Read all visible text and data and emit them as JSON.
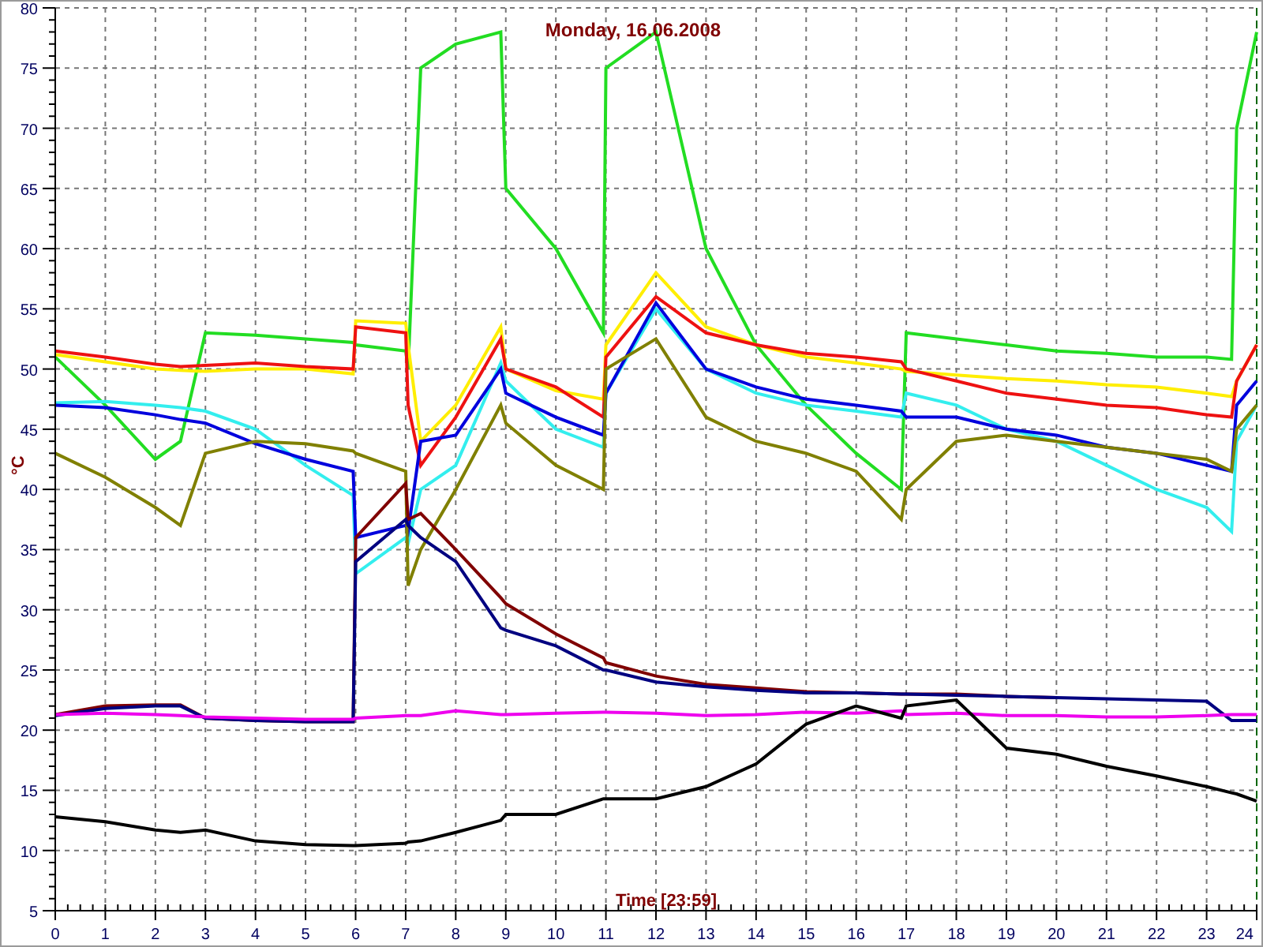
{
  "chart": {
    "chart_data": {
      "type": "line",
      "title": "Monday, 16.06.2008",
      "xlabel": "Time [23:59]",
      "ylabel": "°C",
      "x": [
        0,
        1,
        2,
        2.5,
        3,
        4,
        5,
        5.95,
        6,
        7,
        7.05,
        7.3,
        8,
        8.9,
        9,
        10,
        10.95,
        11,
        12,
        13,
        14,
        15,
        16,
        16.9,
        17,
        18,
        19,
        20,
        21,
        22,
        23,
        23.5,
        23.6,
        24
      ],
      "grid": true,
      "xlim": [
        0,
        24
      ],
      "ylim": [
        5,
        80
      ],
      "xticks": [
        0,
        1,
        2,
        3,
        4,
        5,
        6,
        7,
        8,
        9,
        10,
        11,
        12,
        13,
        14,
        15,
        16,
        17,
        18,
        19,
        20,
        21,
        22,
        23,
        24
      ],
      "yticks": [
        5,
        10,
        15,
        20,
        25,
        30,
        35,
        40,
        45,
        50,
        55,
        60,
        65,
        70,
        75,
        80
      ],
      "series": [
        {
          "color": "#22dd22",
          "values": [
            51,
            47,
            42.5,
            44,
            53,
            52.8,
            52.5,
            52.2,
            52,
            51.5,
            50,
            75,
            77,
            78,
            65,
            60,
            53,
            75,
            78,
            60,
            52,
            47,
            43,
            40,
            53,
            52.5,
            52,
            51.5,
            51.3,
            51,
            51,
            50.8,
            70,
            78
          ]
        },
        {
          "color": "#ffee00",
          "values": [
            51.2,
            50.6,
            50,
            49.9,
            49.8,
            50,
            50,
            49.6,
            54,
            53.8,
            52,
            44,
            47,
            53.5,
            50,
            48.2,
            47.5,
            52,
            58,
            53.5,
            52,
            51,
            50.5,
            50,
            49.8,
            49.5,
            49.2,
            49,
            48.7,
            48.5,
            48,
            47.7,
            49,
            52
          ]
        },
        {
          "color": "#ee1111",
          "values": [
            51.5,
            51,
            50.4,
            50.2,
            50.3,
            50.5,
            50.2,
            50,
            53.5,
            53,
            47,
            42,
            46,
            52.5,
            50,
            48.5,
            46,
            51,
            56,
            53,
            52,
            51.3,
            51,
            50.6,
            50,
            49,
            48,
            47.5,
            47,
            46.8,
            46.2,
            46,
            49,
            52
          ]
        },
        {
          "color": "#33eeee",
          "values": [
            47.2,
            47.3,
            47,
            46.8,
            46.5,
            45,
            42,
            39.5,
            33,
            36,
            35.5,
            40,
            42,
            50.5,
            49,
            45,
            43.5,
            48,
            55,
            50,
            48,
            47,
            46.5,
            46,
            48,
            47,
            45,
            44,
            42,
            40,
            38.5,
            36.5,
            44,
            47
          ]
        },
        {
          "color": "#0000dd",
          "values": [
            47,
            46.8,
            46.2,
            45.8,
            45.5,
            43.8,
            42.5,
            41.5,
            36,
            37,
            36.5,
            44,
            44.5,
            50,
            48,
            46,
            44.5,
            48,
            55.5,
            50,
            48.5,
            47.5,
            47,
            46.5,
            46,
            46,
            45,
            44.5,
            43.5,
            43,
            42,
            41.5,
            47,
            49
          ]
        },
        {
          "color": "#808000",
          "values": [
            43,
            41,
            38.5,
            37,
            43,
            44,
            43.8,
            43.2,
            43,
            41.5,
            32,
            35,
            40,
            47,
            45.5,
            42,
            40,
            50,
            52.5,
            46,
            44,
            43,
            41.5,
            37.5,
            40,
            44,
            44.5,
            44,
            43.5,
            43,
            42.5,
            41.5,
            45,
            47
          ]
        },
        {
          "color": "#800000",
          "values": [
            21.3,
            22,
            22.1,
            22.1,
            21,
            20.8,
            20.7,
            20.7,
            36,
            40.5,
            37.5,
            38,
            35,
            31,
            30.5,
            28,
            26,
            25.6,
            24.5,
            23.8,
            23.5,
            23.2,
            23.1,
            23,
            23,
            23,
            22.8,
            22.7,
            null,
            null,
            null,
            null,
            null,
            null
          ]
        },
        {
          "color": "#000080",
          "values": [
            21.2,
            21.8,
            22,
            22,
            21,
            20.8,
            20.7,
            20.7,
            34,
            37.5,
            37,
            36,
            34,
            28.5,
            28.3,
            27,
            25,
            25,
            24,
            23.6,
            23.3,
            23.1,
            23.1,
            23,
            23,
            22.9,
            22.8,
            22.7,
            22.6,
            22.5,
            22.4,
            20.8,
            20.8,
            20.8
          ]
        },
        {
          "color": "#ee00ee",
          "values": [
            21.3,
            21.4,
            21.3,
            21.2,
            21.1,
            21,
            20.9,
            20.9,
            21,
            21.2,
            21.2,
            21.2,
            21.6,
            21.3,
            21.3,
            21.4,
            21.5,
            21.5,
            21.4,
            21.2,
            21.3,
            21.5,
            21.4,
            21.6,
            21.3,
            21.4,
            21.2,
            21.2,
            21.1,
            21.1,
            21.2,
            21.3,
            21.3,
            21.3
          ]
        },
        {
          "color": "#000000",
          "values": [
            12.8,
            12.4,
            11.7,
            11.5,
            11.7,
            10.8,
            10.5,
            10.4,
            10.4,
            10.6,
            10.7,
            10.8,
            11.5,
            12.5,
            13,
            13,
            14.3,
            14.3,
            14.3,
            15.3,
            17.2,
            20.5,
            22,
            21,
            22,
            22.5,
            18.5,
            18,
            17,
            16.2,
            15.3,
            14.8,
            14.7,
            14.1
          ]
        }
      ]
    }
  }
}
